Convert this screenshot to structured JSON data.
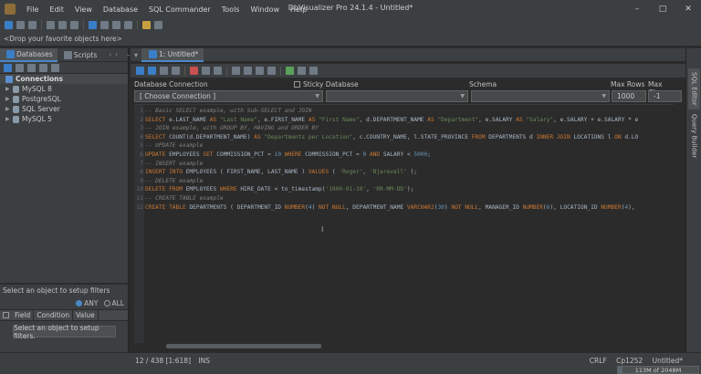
{
  "window": {
    "title": "DbVisualizer Pro 24.1.4 - Untitled*",
    "controls": [
      "–",
      "□",
      "✕"
    ]
  },
  "menu": [
    "File",
    "Edit",
    "View",
    "Database",
    "SQL Commander",
    "Tools",
    "Window",
    "Help"
  ],
  "favorites": {
    "placeholder": "<Drop your favorite objects here>"
  },
  "left_tabs": [
    {
      "label": "Databases",
      "icon": "database-icon",
      "active": true
    },
    {
      "label": "Scripts",
      "icon": "scripts-icon",
      "active": false
    }
  ],
  "tree": {
    "root": "Connections",
    "items": [
      "MySQL 8",
      "PostgreSQL",
      "SQL Server",
      "MySQL 5"
    ]
  },
  "filters": {
    "hint": "Select an object to setup filters",
    "any_label": "ANY",
    "all_label": "ALL",
    "col_field": "Field",
    "col_condition": "Condition",
    "col_value": "Value",
    "button_label": "Select an object to setup filters."
  },
  "editor_tab": {
    "label": "1: Untitled*"
  },
  "connection_bar": {
    "database_connection_label": "Database Connection",
    "sticky_label": "Sticky Database",
    "schema_label": "Schema",
    "max_rows_label": "Max Rows",
    "max_chars_label": "Max Chars",
    "connection_value": "[ Choose Connection ]",
    "max_rows_value": "1000",
    "max_chars_value": "-1"
  },
  "code_lines": [
    {
      "n": "1",
      "parts": [
        [
          "cm",
          "-- Basic SELECT example, with Sub-SELECT and JOIN"
        ]
      ]
    },
    {
      "n": "2",
      "parts": [
        [
          "kw",
          "SELECT "
        ],
        [
          "plain",
          "e.LAST_NAME "
        ],
        [
          "kw",
          "AS "
        ],
        [
          "str",
          "\"Last Name\""
        ],
        [
          "plain",
          ", e.FIRST_NAME "
        ],
        [
          "kw",
          "AS "
        ],
        [
          "str",
          "\"First Name\""
        ],
        [
          "plain",
          ", d.DEPARTMENT_NAME "
        ],
        [
          "kw",
          "AS "
        ],
        [
          "str",
          "\"Department\""
        ],
        [
          "plain",
          ", e.SALARY "
        ],
        [
          "kw",
          "AS "
        ],
        [
          "str",
          "\"Salary\""
        ],
        [
          "plain",
          ", e.SALARY + e.SALARY * e"
        ]
      ]
    },
    {
      "n": "3",
      "parts": [
        [
          "cm",
          "-- JOIN example, with GROUP BY, HAVING and ORDER BY"
        ]
      ]
    },
    {
      "n": "4",
      "parts": [
        [
          "kw",
          "SELECT "
        ],
        [
          "plain",
          "COUNT(d.DEPARTMENT_NAME) "
        ],
        [
          "kw",
          "AS "
        ],
        [
          "str",
          "\"Departments per Location\""
        ],
        [
          "plain",
          ", c.COUNTRY_NAME, l.STATE_PROVINCE "
        ],
        [
          "kw",
          "FROM "
        ],
        [
          "plain",
          "DEPARTMENTS d "
        ],
        [
          "kw",
          "INNER JOIN "
        ],
        [
          "plain",
          "LOCATIONS l "
        ],
        [
          "kw",
          "ON "
        ],
        [
          "plain",
          "d.LO"
        ]
      ]
    },
    {
      "n": "5",
      "parts": [
        [
          "cm",
          "-- UPDATE example"
        ]
      ]
    },
    {
      "n": "6",
      "parts": [
        [
          "kw",
          "UPDATE "
        ],
        [
          "plain",
          "EMPLOYEES "
        ],
        [
          "kw",
          "SET "
        ],
        [
          "plain",
          "COMMISSION_PCT = "
        ],
        [
          "num",
          "10 "
        ],
        [
          "kw",
          "WHERE "
        ],
        [
          "plain",
          "COMMISSION_PCT = "
        ],
        [
          "num",
          "0 "
        ],
        [
          "kw",
          "AND "
        ],
        [
          "plain",
          "SALARY < "
        ],
        [
          "num",
          "5000"
        ],
        [
          "plain",
          ";"
        ]
      ]
    },
    {
      "n": "7",
      "parts": [
        [
          "cm",
          "-- INSERT example"
        ]
      ]
    },
    {
      "n": "8",
      "parts": [
        [
          "kw",
          "INSERT INTO "
        ],
        [
          "plain",
          "EMPLOYEES ( FIRST_NAME, LAST_NAME ) "
        ],
        [
          "kw",
          "VALUES "
        ],
        [
          "plain",
          "( "
        ],
        [
          "str",
          "'Roger'"
        ],
        [
          "plain",
          ", "
        ],
        [
          "str",
          "'Bjarevall'"
        ],
        [
          "plain",
          " );"
        ]
      ]
    },
    {
      "n": "9",
      "parts": [
        [
          "cm",
          "-- DELETE example"
        ]
      ]
    },
    {
      "n": "10",
      "parts": [
        [
          "kw",
          "DELETE FROM "
        ],
        [
          "plain",
          "EMPLOYEES "
        ],
        [
          "kw",
          "WHERE "
        ],
        [
          "plain",
          "HIRE_DATE < to_timestamp("
        ],
        [
          "str",
          "'1900-01-10'"
        ],
        [
          "plain",
          ", "
        ],
        [
          "str",
          "'RR-MM-DD'"
        ],
        [
          "plain",
          ");"
        ]
      ]
    },
    {
      "n": "11",
      "parts": [
        [
          "cm",
          "-- CREATE TABLE example"
        ]
      ]
    },
    {
      "n": "12",
      "parts": [
        [
          "kw",
          "CREATE TABLE "
        ],
        [
          "plain",
          "DEPARTMENTS ( DEPARTMENT_ID "
        ],
        [
          "kw",
          "NUMBER"
        ],
        [
          "plain",
          "("
        ],
        [
          "num",
          "4"
        ],
        [
          "plain",
          ") "
        ],
        [
          "kw",
          "NOT NULL"
        ],
        [
          "plain",
          ", DEPARTMENT_NAME "
        ],
        [
          "kw",
          "VARCHAR2"
        ],
        [
          "plain",
          "("
        ],
        [
          "num",
          "30"
        ],
        [
          "plain",
          ") "
        ],
        [
          "kw",
          "NOT NULL"
        ],
        [
          "plain",
          ", MANAGER_ID "
        ],
        [
          "kw",
          "NUMBER"
        ],
        [
          "plain",
          "("
        ],
        [
          "num",
          "6"
        ],
        [
          "plain",
          "), LOCATION_ID "
        ],
        [
          "kw",
          "NUMBER"
        ],
        [
          "plain",
          "("
        ],
        [
          "num",
          "4"
        ],
        [
          "plain",
          "),"
        ]
      ]
    }
  ],
  "right_tabs": [
    {
      "label": "SQL Editor",
      "active": true
    },
    {
      "label": "Query Builder",
      "active": false
    }
  ],
  "status": {
    "position": "12 / 438 [1:618]",
    "mode": "INS",
    "line_ending": "CRLF",
    "encoding": "Cp1252",
    "file": "Untitled*",
    "memory": "113M of 2048M",
    "memory_fraction": 0.055
  }
}
